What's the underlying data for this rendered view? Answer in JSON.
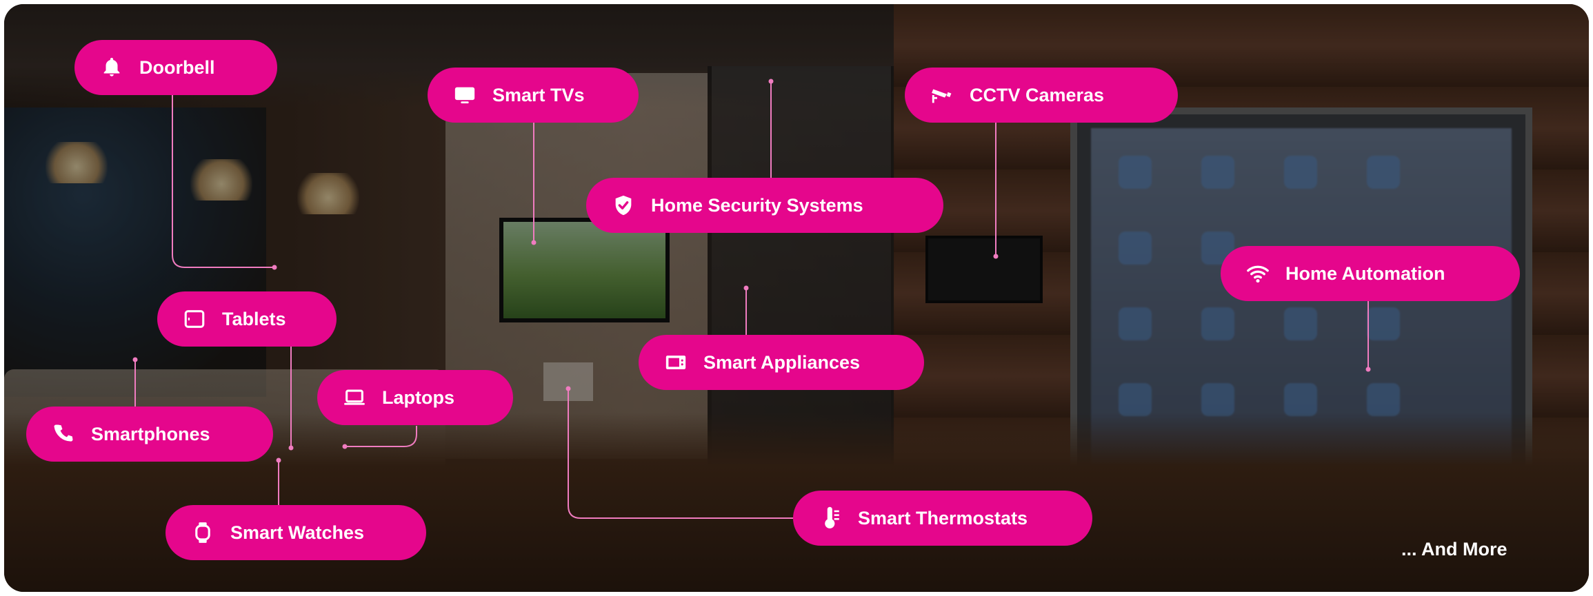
{
  "labels": {
    "doorbell": "Doorbell",
    "smart_tvs": "Smart TVs",
    "cctv_cameras": "CCTV Cameras",
    "home_security": "Home Security Systems",
    "home_automation": "Home Automation",
    "tablets": "Tablets",
    "smart_appliances": "Smart Appliances",
    "laptops": "Laptops",
    "smartphones": "Smartphones",
    "smart_watches": "Smart Watches",
    "smart_thermostats": "Smart Thermostats",
    "and_more": "... And More"
  },
  "icons": {
    "doorbell": "bell-icon",
    "smart_tvs": "tv-icon",
    "cctv_cameras": "cctv-camera-icon",
    "home_security": "shield-check-icon",
    "home_automation": "wifi-icon",
    "tablets": "tablet-icon",
    "smart_appliances": "microwave-icon",
    "laptops": "laptop-icon",
    "smartphones": "phone-icon",
    "smart_watches": "watch-icon",
    "smart_thermostats": "thermometer-icon"
  },
  "colors": {
    "accent": "#e5068c",
    "connector": "#f07cc0",
    "text": "#ffffff"
  }
}
